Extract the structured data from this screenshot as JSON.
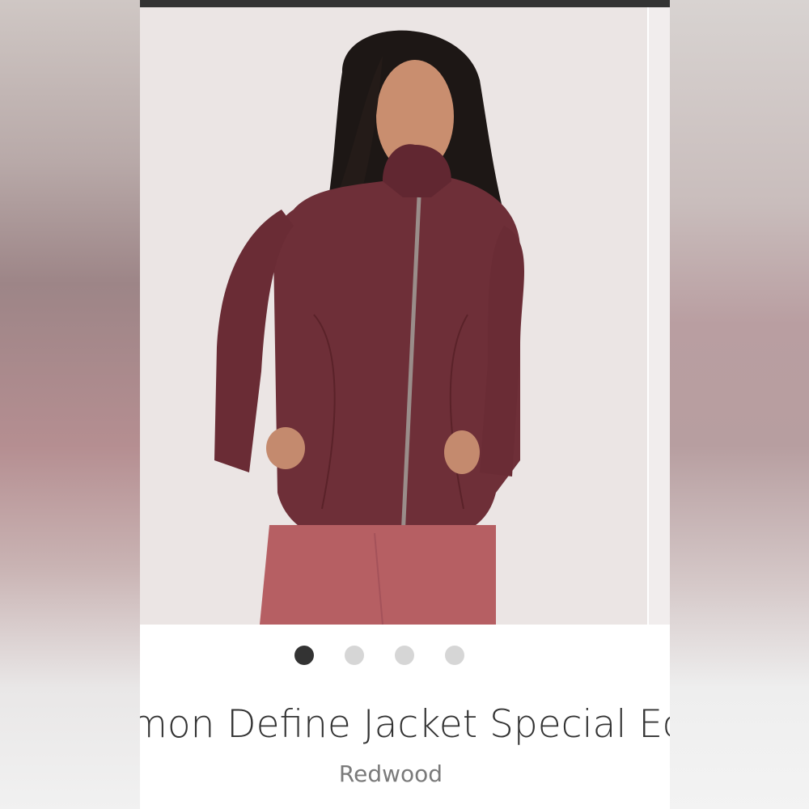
{
  "product": {
    "title": "mon Define Jacket Special Ec",
    "color_name": "Redwood",
    "image_alt_icon": "product-photo"
  },
  "carousel": {
    "total_slides": 4,
    "active_slide": 1,
    "dot_labels": [
      "slide-1",
      "slide-2",
      "slide-3",
      "slide-4"
    ]
  },
  "colors": {
    "jacket": "#6e2f38",
    "leggings": "#b65f63",
    "background": "#ebe5e4",
    "dot_active": "#333333",
    "dot_inactive": "#d6d6d6"
  }
}
